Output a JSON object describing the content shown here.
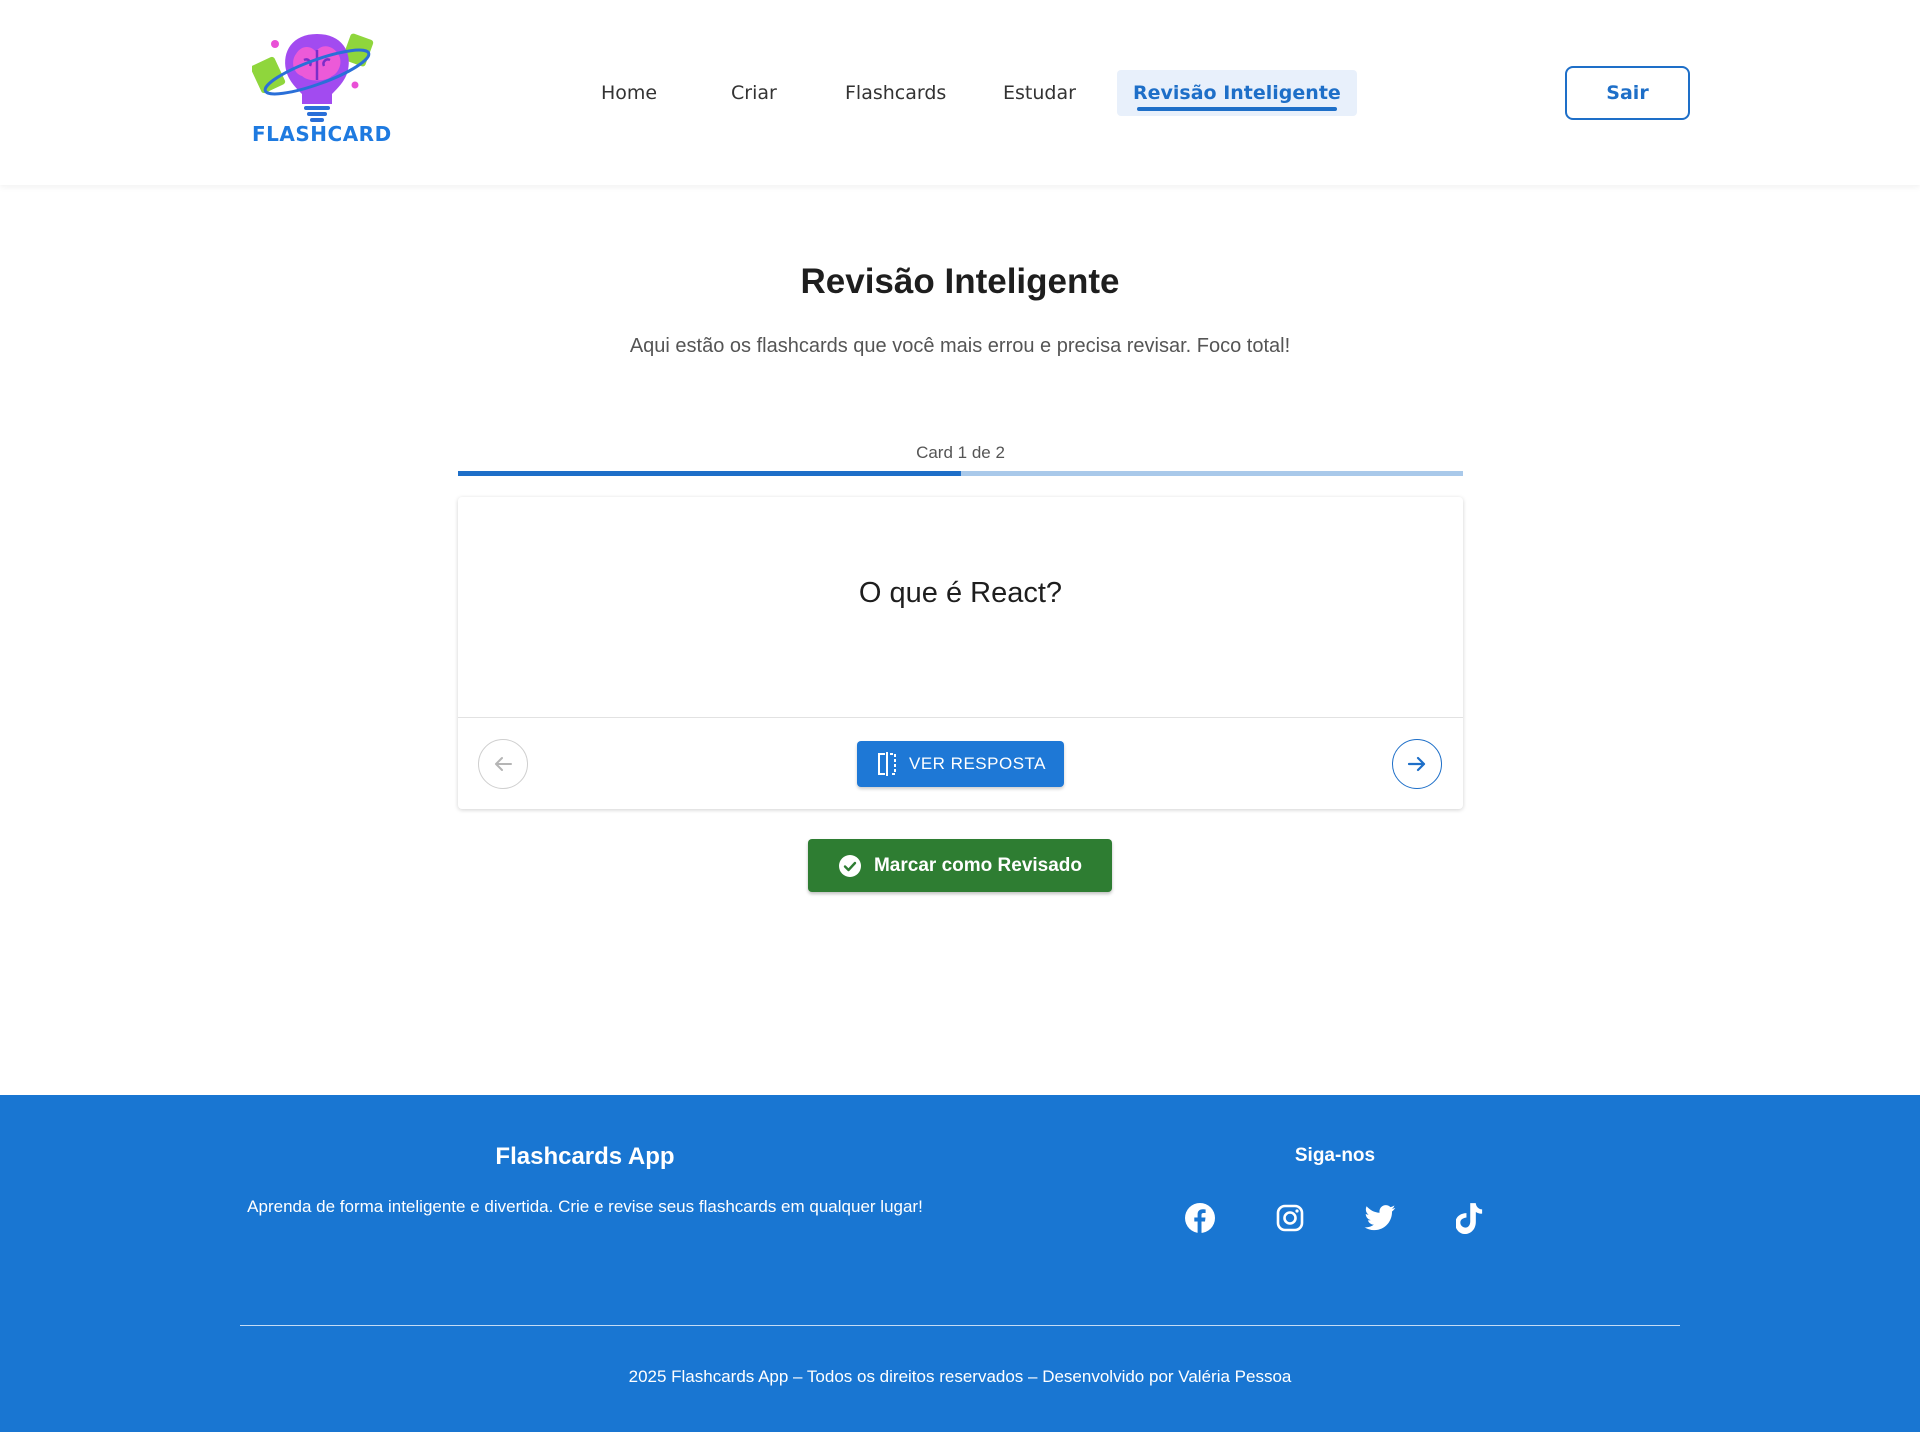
{
  "brand": {
    "logo_text": "FLASHCARD"
  },
  "nav": {
    "items": [
      {
        "label": "Home"
      },
      {
        "label": "Criar"
      },
      {
        "label": "Flashcards"
      },
      {
        "label": "Estudar"
      },
      {
        "label": "Revisão Inteligente",
        "active": true
      }
    ],
    "logout_label": "Sair"
  },
  "main": {
    "title": "Revisão Inteligente",
    "subtitle": "Aqui estão os flashcards que você mais errou e precisa revisar. Foco total!",
    "counter": "Card 1 de 2",
    "progress_fraction": 0.5,
    "card": {
      "question": "O que é React?",
      "show_answer_label": "VER RESPOSTA",
      "prev_icon": "arrow-left-icon",
      "next_icon": "arrow-right-icon"
    },
    "mark_reviewed_label": "Marcar como Revisado"
  },
  "footer": {
    "title": "Flashcards App",
    "description": "Aprenda de forma inteligente e divertida. Crie e revise seus flashcards em qualquer lugar!",
    "follow_label": "Siga-nos",
    "social": [
      "facebook-icon",
      "instagram-icon",
      "twitter-icon",
      "tiktok-icon"
    ],
    "copyright": "2025 Flashcards App – Todos os direitos reservados – Desenvolvido por Valéria Pessoa"
  },
  "colors": {
    "primary": "#1976d2",
    "accent_blue": "#1e6fc8",
    "success": "#2e7d32",
    "progress_track": "#a9c9ea"
  }
}
